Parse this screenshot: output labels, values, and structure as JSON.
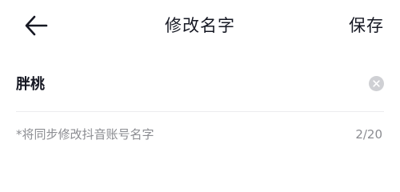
{
  "header": {
    "back_icon": "arrow-left-icon",
    "title": "修改名字",
    "save_label": "保存"
  },
  "name_field": {
    "value": "胖桃",
    "clear_icon": "clear-circle-icon"
  },
  "hint": {
    "text": "*将同步修改抖音账号名字",
    "counter": "2/20"
  },
  "colors": {
    "text_primary": "#161823",
    "text_secondary": "#8b8c91",
    "divider": "#ececee",
    "clear_button": "#cfd0d4"
  }
}
